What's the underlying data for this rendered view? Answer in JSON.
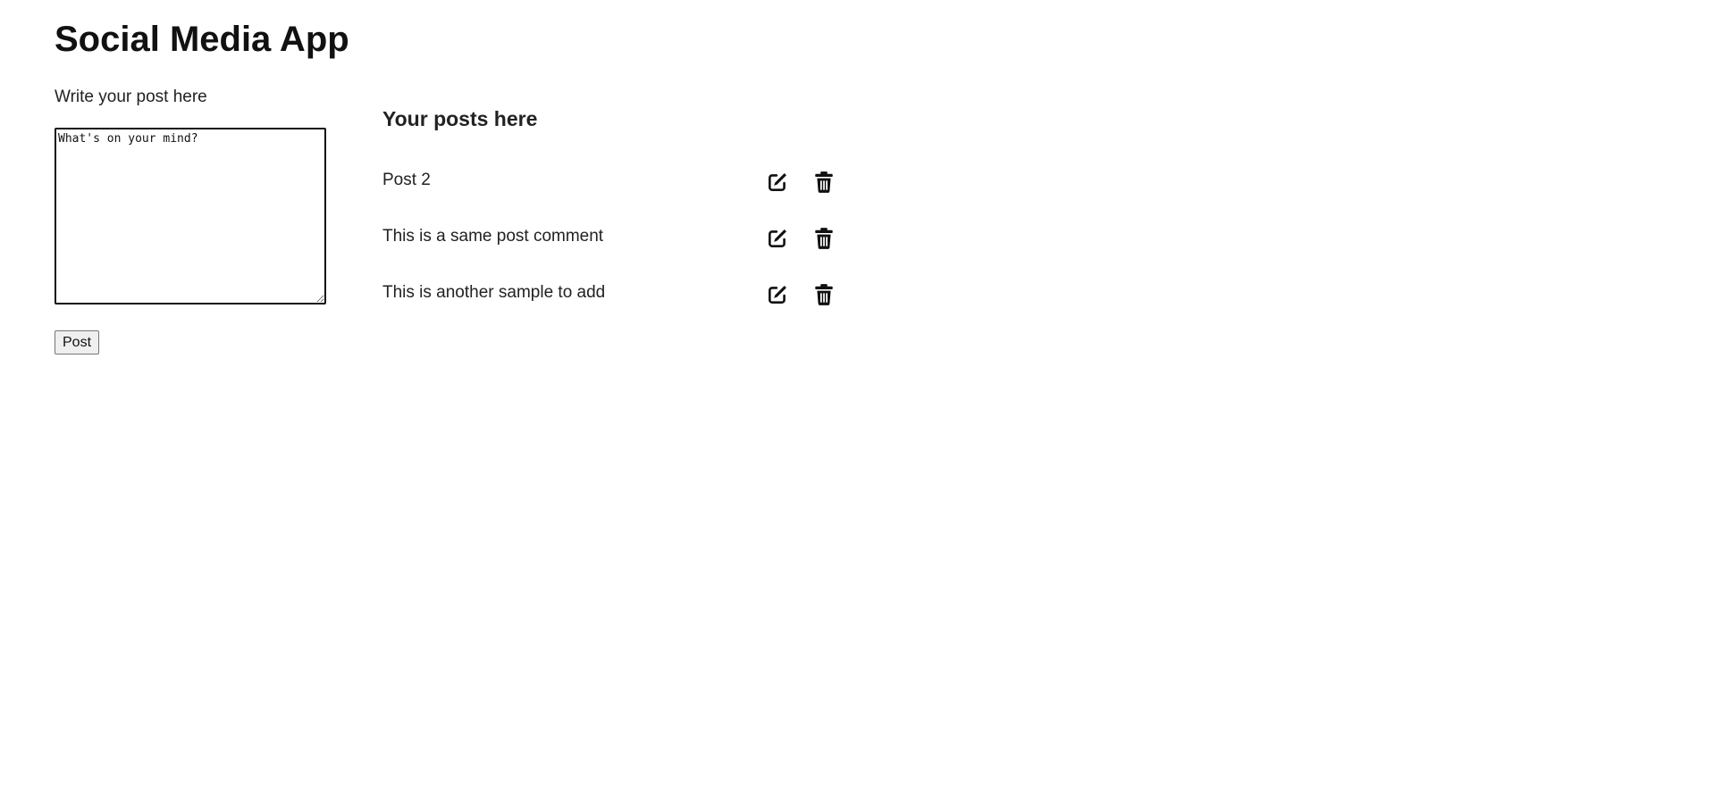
{
  "app": {
    "title": "Social Media App"
  },
  "compose": {
    "label": "Write your post here",
    "value": "What's on your mind?",
    "button_label": "Post"
  },
  "posts": {
    "heading": "Your posts here",
    "items": [
      {
        "text": "Post 2",
        "edit_icon": "edit-icon",
        "delete_icon": "trash-icon"
      },
      {
        "text": "This is a same post comment",
        "edit_icon": "edit-icon",
        "delete_icon": "trash-icon"
      },
      {
        "text": "This is another sample to add",
        "edit_icon": "edit-icon",
        "delete_icon": "trash-icon"
      }
    ]
  },
  "colors": {
    "text": "#222222",
    "icon": "#111111"
  }
}
